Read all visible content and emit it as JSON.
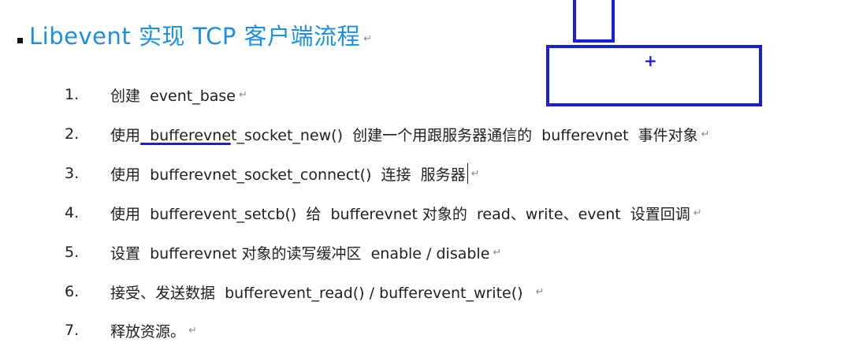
{
  "title": {
    "text": "Libevent 实现  TCP  客户端流程"
  },
  "para_mark": "↵",
  "steps": [
    {
      "num": "1.",
      "text": "创建  event_base"
    },
    {
      "num": "2.",
      "text": "使用  bufferevnet_socket_new()  创建一个用跟服务器通信的  bufferevnet  事件对象"
    },
    {
      "num": "3.",
      "text": "使用  bufferevnet_socket_connect()  连接  服务器"
    },
    {
      "num": "4.",
      "text": "使用  bufferevent_setcb()  给  bufferevnet 对象的  read、write、event  设置回调"
    },
    {
      "num": "5.",
      "text": "设置  bufferevnet 对象的读写缓冲区  enable / disable"
    },
    {
      "num": "6.",
      "text": "接受、发送数据  bufferevent_read() / bufferevent_write()  "
    },
    {
      "num": "7.",
      "text": "释放资源。"
    }
  ],
  "annotation": {
    "plus": "+"
  },
  "colors": {
    "title": "#1d8fe0",
    "ink": "#1a1fd6",
    "text": "#1f1f1f"
  }
}
